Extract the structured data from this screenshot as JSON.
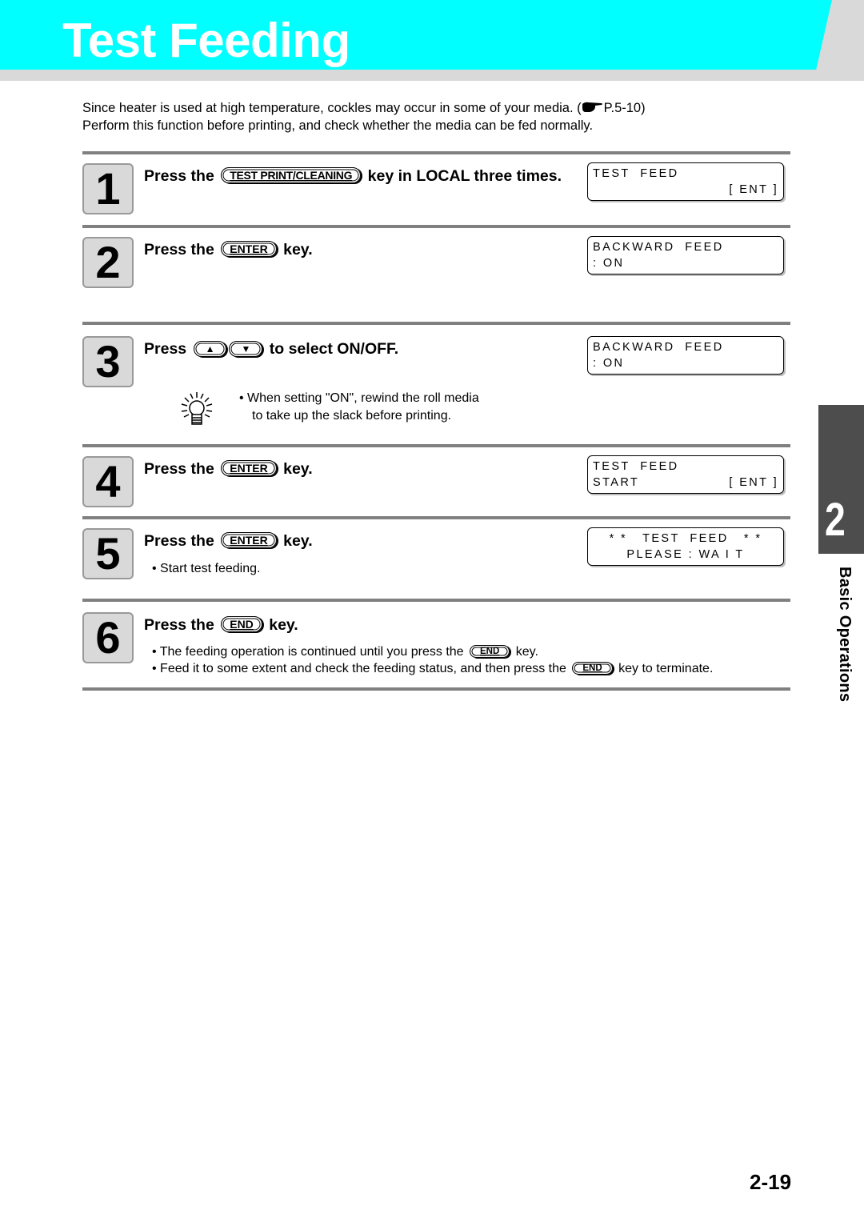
{
  "header": {
    "title": "Test Feeding"
  },
  "intro": {
    "line1": "Since heater is used at high temperature, cockles may occur in some of your media. (",
    "ref_icon": "pointing-hand-icon",
    "ref_page": "P.5-10)",
    "line2": "Perform this function before printing, and check whether the media can be fed normally."
  },
  "steps": [
    {
      "number": "1",
      "title_before": "Press the",
      "key": "TEST PRINT/CLEANING",
      "title_after": "key in LOCAL three times.",
      "lcd": {
        "line1_left": "TEST  FEED",
        "line1_right": "",
        "line2_left": "",
        "line2_right": "[ ENT ]"
      }
    },
    {
      "number": "2",
      "title_before": "Press the",
      "key": "ENTER",
      "title_after": "key.",
      "lcd": {
        "line1_left": "BACKWARD  FEED",
        "line2_left": ": ON"
      }
    },
    {
      "number": "3",
      "title_before": "Press",
      "keys": [
        "▲",
        "▼"
      ],
      "title_after": "to select ON/OFF.",
      "lcd": {
        "line1_left": "BACKWARD  FEED",
        "line2_left": ": ON"
      },
      "note_icon": "lightbulb-icon",
      "note_lines": [
        "•  When setting \"ON\", rewind the roll media",
        "to take up the slack before printing."
      ]
    },
    {
      "number": "4",
      "title_before": "Press the",
      "key": "ENTER",
      "title_after": "key.",
      "lcd": {
        "line1_left": "TEST  FEED",
        "line2_left": "START",
        "line2_right": "[ ENT ]"
      }
    },
    {
      "number": "5",
      "title_before": "Press the",
      "key": "ENTER",
      "title_after": "key.",
      "bullets": [
        "• Start test feeding."
      ],
      "lcd": {
        "line1_center": "* *   TEST  FEED   * *",
        "line2_center": "PLEASE : WA I T"
      }
    },
    {
      "number": "6",
      "title_before": "Press the",
      "key": "END",
      "title_after": "key.",
      "bullets": [
        {
          "before": "• The feeding operation is continued until you press the",
          "key": "END",
          "after": "key."
        },
        {
          "before": "• Feed it to some extent and check the feeding status, and then press the",
          "key": "END",
          "after": "key to terminate."
        }
      ]
    }
  ],
  "chapter_tab": {
    "number": "2",
    "name": "Basic Operations"
  },
  "page_number": "2-19"
}
